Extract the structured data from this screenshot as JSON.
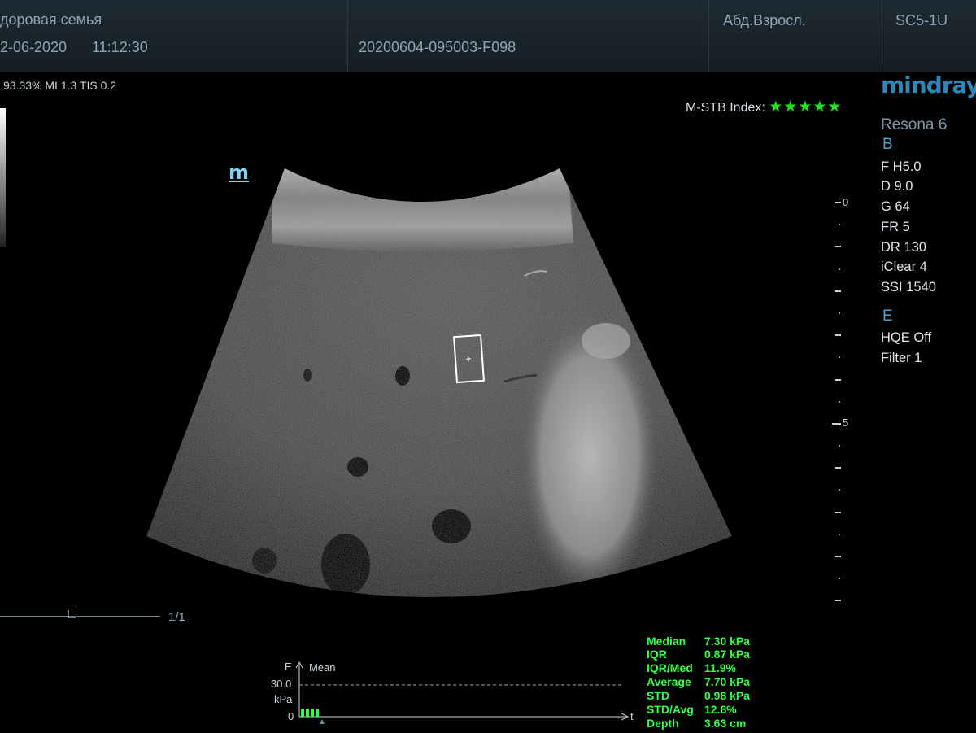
{
  "header": {
    "patient_name": "доровая семья",
    "date": "2-06-2020",
    "time": "11:12:30",
    "exam_id": "20200604-095003-F098",
    "preset": "Абд.Взросл.",
    "probe": "SC5-1U"
  },
  "status_line": "93.33%  MI 1.3 TIS 0.2",
  "stb_index": {
    "label": "M-STB Index:",
    "stars": "★★★★★",
    "rating": 5
  },
  "device": {
    "brand": "mindray",
    "model": "Resona 6"
  },
  "mode_b": {
    "label": "B",
    "params": [
      "F H5.0",
      "D 9.0",
      "G 64",
      "FR 5",
      "DR 130",
      "iClear 4",
      "SSI 1540"
    ]
  },
  "mode_e": {
    "label": "E",
    "params": [
      "HQE Off",
      "Filter 1"
    ]
  },
  "image_marker": "m",
  "depth_scale": {
    "labels": [
      "0",
      "5"
    ]
  },
  "cine": {
    "label": "1/1"
  },
  "results": [
    {
      "label": "Median",
      "value": "7.30 kPa"
    },
    {
      "label": "IQR",
      "value": "0.87 kPa"
    },
    {
      "label": "IQR/Med",
      "value": "11.9%"
    },
    {
      "label": "Average",
      "value": "7.70 kPa"
    },
    {
      "label": "STD",
      "value": "0.98 kPa"
    },
    {
      "label": "STD/Avg",
      "value": "12.8%"
    },
    {
      "label": "Depth",
      "value": "3.63 cm"
    }
  ],
  "graph": {
    "axis_e": "E",
    "mean_label": "Mean",
    "ymax": "30.0",
    "unit": "kPa",
    "ymin": "0",
    "axis_t": "t",
    "bars": [
      7.0,
      7.5,
      7.3,
      7.6
    ]
  },
  "colors": {
    "measure": "#33ff44",
    "accent": "#4f9fcf",
    "brand": "#2f87b8"
  }
}
